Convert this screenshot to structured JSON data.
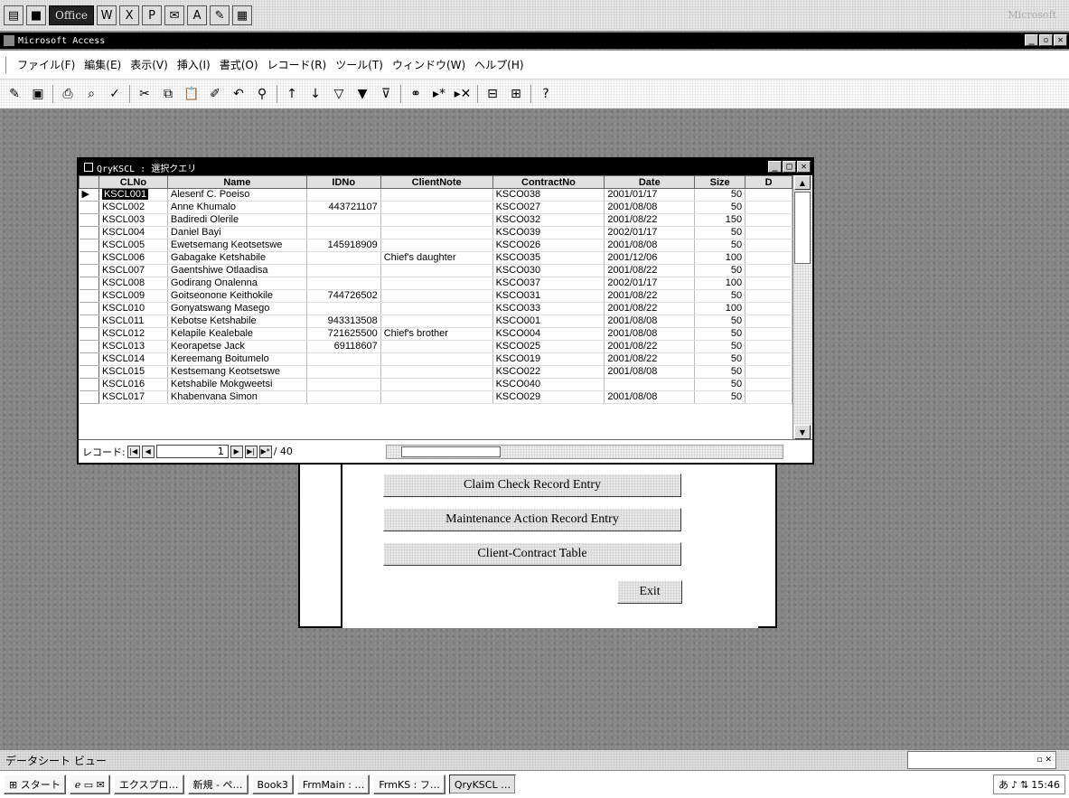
{
  "office_bar": {
    "office_label": "Office",
    "ms_label": "Microsoft"
  },
  "access_window": {
    "title": "Microsoft Access"
  },
  "menu": {
    "items": [
      "ファイル(F)",
      "編集(E)",
      "表示(V)",
      "挿入(I)",
      "書式(O)",
      "レコード(R)",
      "ツール(T)",
      "ウィンドウ(W)",
      "ヘルプ(H)"
    ]
  },
  "datasheet": {
    "title": "QryKSCL : 選択クエリ",
    "columns": [
      "CLNo",
      "Name",
      "IDNo",
      "ClientNote",
      "ContractNo",
      "Date",
      "Size",
      "D"
    ],
    "rows": [
      [
        "KSCL001",
        "Alesenf C. Poeiso",
        "",
        "",
        "KSCO038",
        "2001/01/17",
        "50"
      ],
      [
        "KSCL002",
        "Anne Khumalo",
        "443721107",
        "",
        "KSCO027",
        "2001/08/08",
        "50"
      ],
      [
        "KSCL003",
        "Badiredi Olerile",
        "",
        "",
        "KSCO032",
        "2001/08/22",
        "150"
      ],
      [
        "KSCL004",
        "Daniel Bayi",
        "",
        "",
        "KSCO039",
        "2002/01/17",
        "50"
      ],
      [
        "KSCL005",
        "Ewetsemang Keotsetswe",
        "145918909",
        "",
        "KSCO026",
        "2001/08/08",
        "50"
      ],
      [
        "KSCL006",
        "Gabagake Ketshabile",
        "",
        "Chief's daughter",
        "KSCO035",
        "2001/12/06",
        "100"
      ],
      [
        "KSCL007",
        "Gaentshiwe Otlaadisa",
        "",
        "",
        "KSCO030",
        "2001/08/22",
        "50"
      ],
      [
        "KSCL008",
        "Godirang Onalenna",
        "",
        "",
        "KSCO037",
        "2002/01/17",
        "100"
      ],
      [
        "KSCL009",
        "Goitseonone Keithokile",
        "744726502",
        "",
        "KSCO031",
        "2001/08/22",
        "50"
      ],
      [
        "KSCL010",
        "Gonyatswang Masego",
        "",
        "",
        "KSCO033",
        "2001/08/22",
        "100"
      ],
      [
        "KSCL011",
        "Kebotse Ketshabile",
        "943313508",
        "",
        "KSCO001",
        "2001/08/08",
        "50"
      ],
      [
        "KSCL012",
        "Kelapile Kealebale",
        "721625500",
        "Chief's brother",
        "KSCO004",
        "2001/08/08",
        "50"
      ],
      [
        "KSCL013",
        "Keorapetse Jack",
        "69118607",
        "",
        "KSCO025",
        "2001/08/22",
        "50"
      ],
      [
        "KSCL014",
        "Kereemang Boitumelo",
        "",
        "",
        "KSCO019",
        "2001/08/22",
        "50"
      ],
      [
        "KSCL015",
        "Kestsemang Keotsetswe",
        "",
        "",
        "KSCO022",
        "2001/08/08",
        "50"
      ],
      [
        "KSCL016",
        "Ketshabile Mokgweetsi",
        "",
        "",
        "KSCO040",
        "",
        "50"
      ],
      [
        "KSCL017",
        "Khabenvana Simon",
        "",
        "",
        "KSCO029",
        "2001/08/08",
        "50"
      ]
    ],
    "nav_label": "レコード:",
    "current_record": "1",
    "total_records": "/ 40"
  },
  "form": {
    "buttons": [
      "Claim Check Record Entry",
      "Maintenance Action Record Entry",
      "Client-Contract Table"
    ],
    "exit_label": "Exit"
  },
  "status": {
    "text": "データシート ビュー"
  },
  "taskbar": {
    "start_label": "スタート",
    "buttons": [
      "エクスプロ…",
      "新規 - ペ…",
      "Book3",
      "FrmMain : …",
      "FrmKS : フ…",
      "QryKSCL …"
    ],
    "clock": "15:46"
  }
}
